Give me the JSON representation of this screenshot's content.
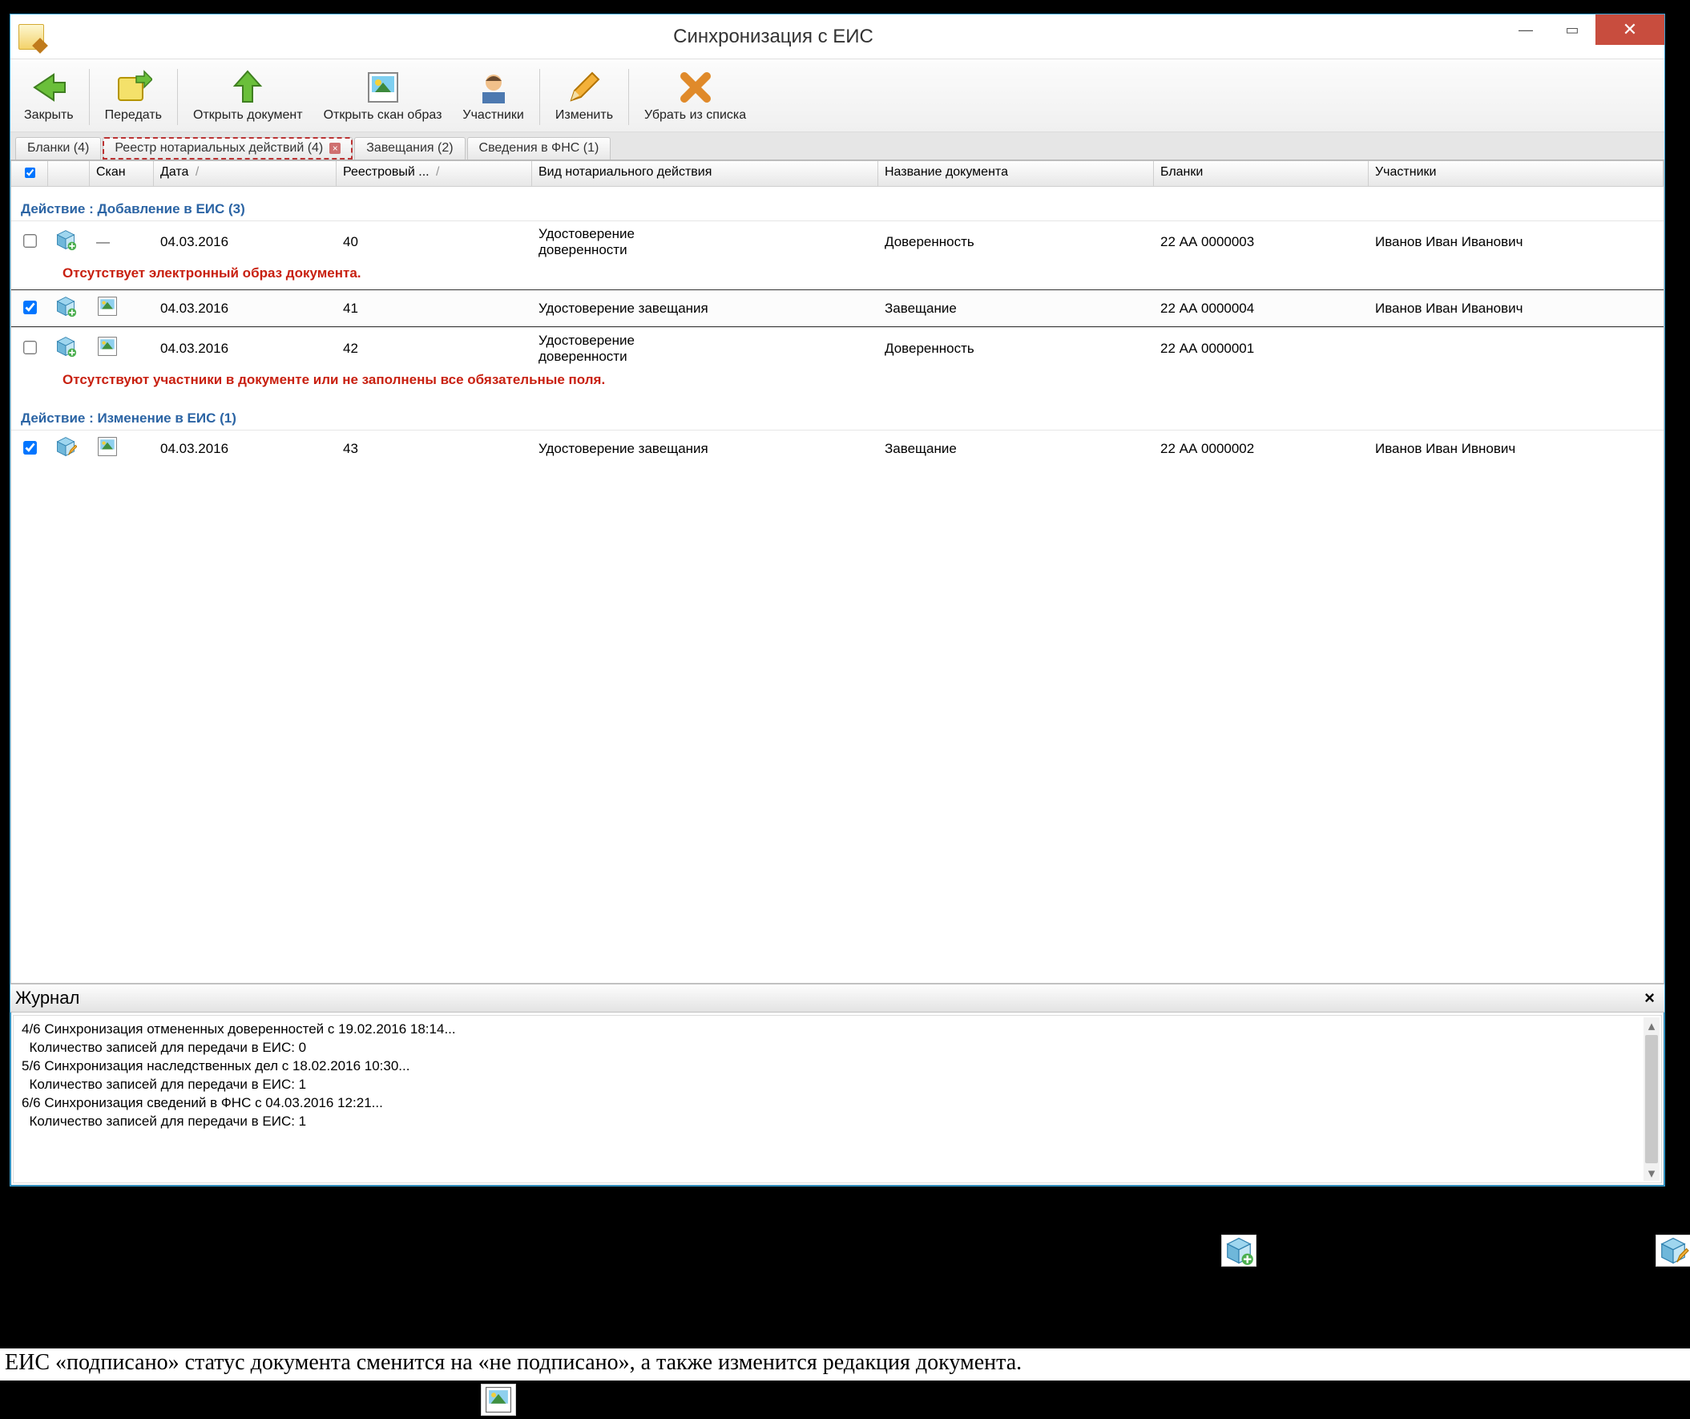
{
  "window": {
    "title": "Синхронизация с ЕИС"
  },
  "toolbar": {
    "close": "Закрыть",
    "send": "Передать",
    "openDoc": "Открыть документ",
    "openScan": "Открыть скан образ",
    "participants": "Участники",
    "edit": "Изменить",
    "remove": "Убрать из списка"
  },
  "tabs": {
    "blanks": "Бланки (4)",
    "registry": "Реестр нотариальных действий (4)",
    "wills": "Завещания (2)",
    "fns": "Сведения в ФНС (1)"
  },
  "columns": {
    "scan": "Скан",
    "date": "Дата",
    "regnum": "Реестровый ...",
    "type": "Вид нотариального действия",
    "doc": "Название документа",
    "blanks": "Бланки",
    "participants": "Участники"
  },
  "group1": "Действие : Добавление в ЕИС (3)",
  "group2": "Действие : Изменение в ЕИС (1)",
  "rows": [
    {
      "checked": false,
      "hasScan": false,
      "date": "04.03.2016",
      "reg": "40",
      "type1": "Удостоверение",
      "type2": "доверенности",
      "doc": "Доверенность",
      "blank": "22 АА 0000003",
      "part": "Иванов Иван Иванович",
      "error": "Отсутствует электронный образ документа."
    },
    {
      "checked": true,
      "hasScan": true,
      "date": "04.03.2016",
      "reg": "41",
      "type1": "Удостоверение завещания",
      "type2": "",
      "doc": "Завещание",
      "blank": "22 АА 0000004",
      "part": "Иванов Иван Иванович",
      "selected": true
    },
    {
      "checked": false,
      "hasScan": true,
      "date": "04.03.2016",
      "reg": "42",
      "type1": "Удостоверение",
      "type2": "доверенности",
      "doc": "Доверенность",
      "blank": "22 АА 0000001",
      "part": "",
      "error": "Отсутствуют участники в документе или не заполнены все обязательные поля."
    }
  ],
  "rows2": [
    {
      "checked": true,
      "hasScan": true,
      "editIcon": true,
      "date": "04.03.2016",
      "reg": "43",
      "type1": "Удостоверение завещания",
      "type2": "",
      "doc": "Завещание",
      "blank": "22 АА 0000002",
      "part": "Иванов Иван Ивнович"
    }
  ],
  "journal": {
    "title": "Журнал",
    "lines": [
      "4/6 Синхронизация отмененных доверенностей с 19.02.2016 18:14...",
      "  Количество записей для передачи в ЕИС: 0",
      "5/6 Синхронизация наследственных дел с 18.02.2016 10:30...",
      "  Количество записей для передачи в ЕИС: 1",
      "6/6 Синхронизация сведений в ФНС с 04.03.2016 12:21...",
      "  Количество записей для передачи в ЕИС: 1"
    ]
  },
  "below": {
    "paragraph": "ЕИС «подписано» статус документа сменится на «не подписано», а также изменится редакция документа."
  }
}
